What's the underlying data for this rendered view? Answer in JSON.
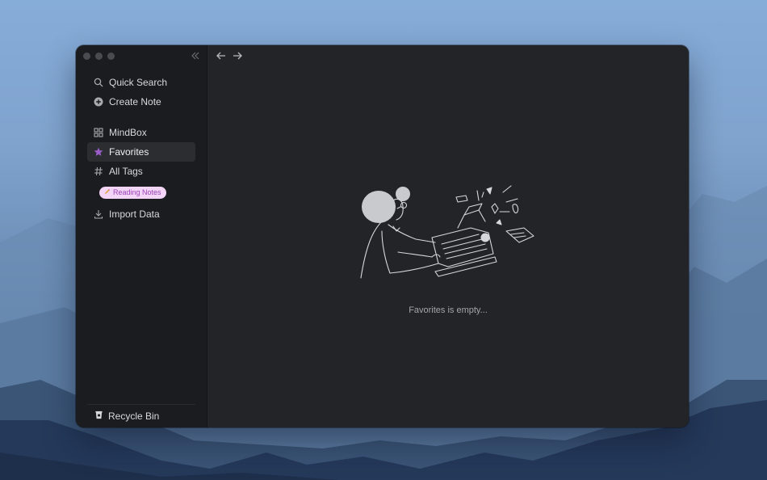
{
  "sidebar": {
    "quick_search": "Quick Search",
    "create_note": "Create Note",
    "mindbox": "MindBox",
    "favorites": "Favorites",
    "all_tags": "All Tags",
    "tag_label": "Reading Notes",
    "import_data": "Import Data",
    "recycle_bin": "Recycle Bin"
  },
  "main": {
    "empty_message": "Favorites is empty..."
  },
  "colors": {
    "accent": "#9a5cc6",
    "tag_bg": "#f3d6f7",
    "tag_text": "#9a3fb6"
  },
  "icons": [
    "close-dot",
    "minimize-dot",
    "zoom-dot",
    "collapse-sidebar-icon",
    "back-arrow-icon",
    "forward-arrow-icon",
    "search-icon",
    "plus-circle-icon",
    "grid-icon",
    "star-icon",
    "hash-icon",
    "pencil-icon",
    "download-icon",
    "trash-icon"
  ]
}
